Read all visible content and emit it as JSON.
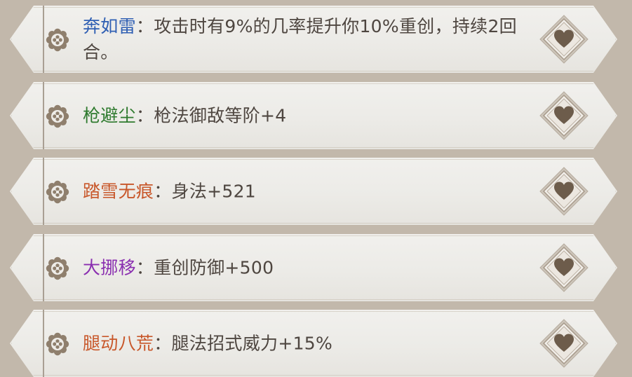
{
  "colors": {
    "blue": "#2f5fb3",
    "green": "#2e7a2e",
    "orange": "#c8572a",
    "purple": "#8a2fb0",
    "text": "#4e4640",
    "icon": "#8f7f6d"
  },
  "items": [
    {
      "name": "奔如雷",
      "name_color": "#2f5fb3",
      "separator": "：",
      "effect": "攻击时有9%的几率提升你10%重创，持续2回合。",
      "icon": "flower-icon",
      "badge_icon": "heart-icon"
    },
    {
      "name": "枪避尘",
      "name_color": "#2e7a2e",
      "separator": "：",
      "effect": "枪法御敌等阶+4",
      "icon": "flower-icon",
      "badge_icon": "heart-icon"
    },
    {
      "name": "踏雪无痕",
      "name_color": "#c8572a",
      "separator": "：",
      "effect": "身法+521",
      "icon": "flower-icon",
      "badge_icon": "heart-icon"
    },
    {
      "name": "大挪移",
      "name_color": "#8a2fb0",
      "separator": "：",
      "effect": "重创防御+500",
      "icon": "flower-icon",
      "badge_icon": "heart-icon"
    },
    {
      "name": "腿动八荒",
      "name_color": "#c8572a",
      "separator": "：",
      "effect": "腿法招式威力+15%",
      "icon": "flower-icon",
      "badge_icon": "heart-icon"
    }
  ]
}
